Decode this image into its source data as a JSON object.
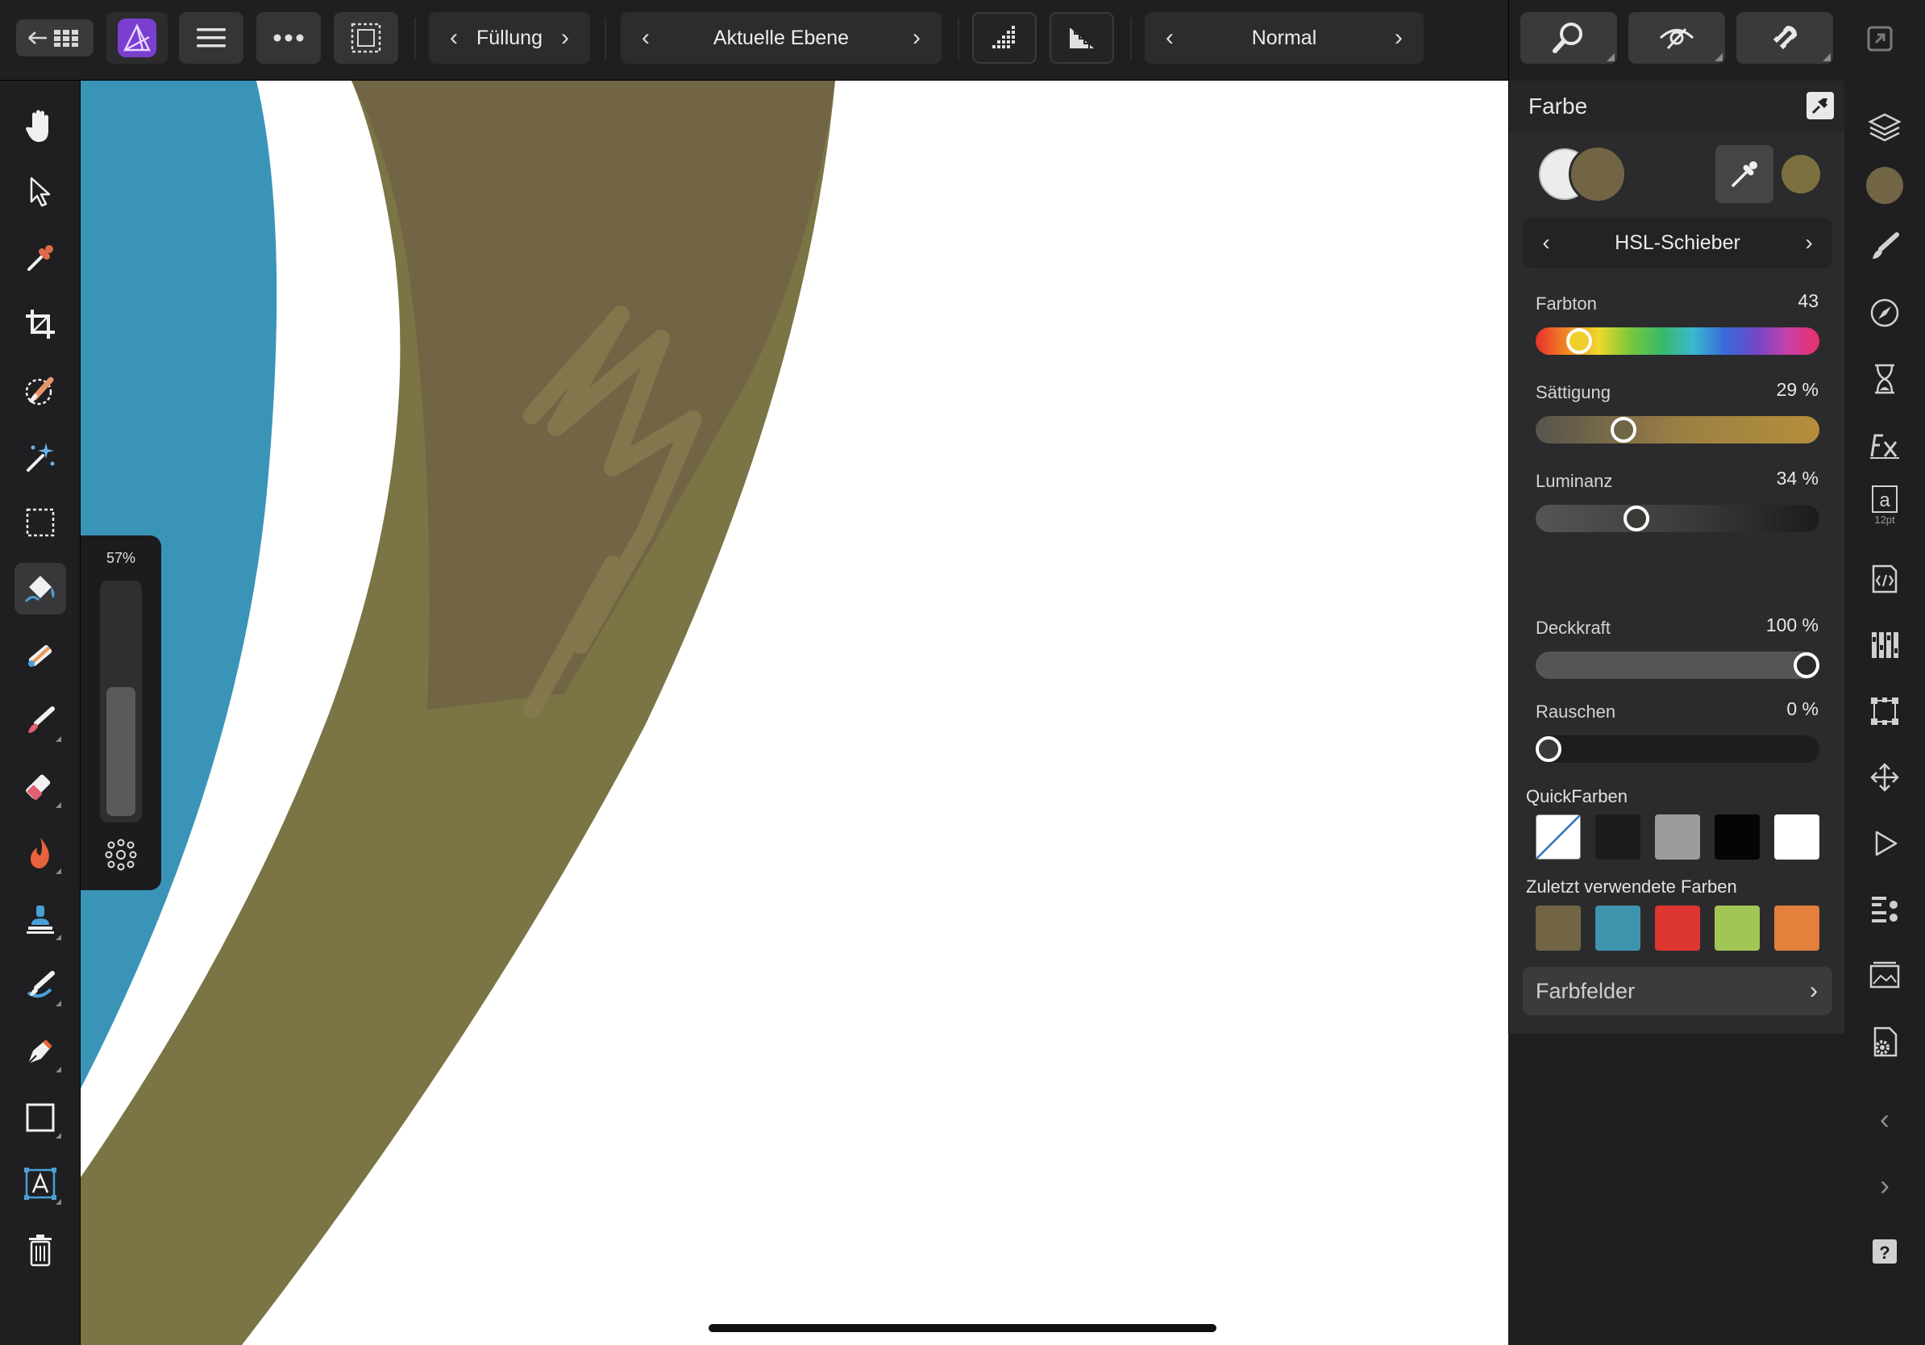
{
  "toolbar": {
    "fill_label": "Füllung",
    "layer_label": "Aktuelle Ebene",
    "blend_label": "Normal"
  },
  "brush": {
    "size_label": "57%",
    "size_value": 0.57
  },
  "color_panel": {
    "title": "Farbe",
    "mode_label": "HSL-Schieber",
    "primary_color": "#716546",
    "secondary_color": "#ececec",
    "picked_color": "#7c7040",
    "sliders": [
      {
        "name": "hue",
        "label": "Farbton",
        "value": "43",
        "fraction": 0.12
      },
      {
        "name": "saturation",
        "label": "Sättigung",
        "value": "29 %",
        "fraction": 0.29
      },
      {
        "name": "luminance",
        "label": "Luminanz",
        "value": "34 %",
        "fraction": 0.34
      },
      {
        "name": "opacity",
        "label": "Deckkraft",
        "value": "100 %",
        "fraction": 1.0
      },
      {
        "name": "noise",
        "label": "Rauschen",
        "value": "0 %",
        "fraction": 0.0
      }
    ],
    "quick_colors_label": "QuickFarben",
    "quick_colors": [
      "none",
      "#1e1b1b",
      "#9c9c9c",
      "#050505",
      "#ffffff"
    ],
    "recent_colors_label": "Zuletzt verwendete Farben",
    "recent_colors": [
      "#716546",
      "#3e94ad",
      "#dd3530",
      "#a2c655",
      "#e3803b"
    ],
    "swatches_label": "Farbfelder"
  },
  "canvas": {
    "blue_color": "#3a94b8",
    "olive_color": "#7b7444",
    "dark_olive_color": "#716546"
  }
}
